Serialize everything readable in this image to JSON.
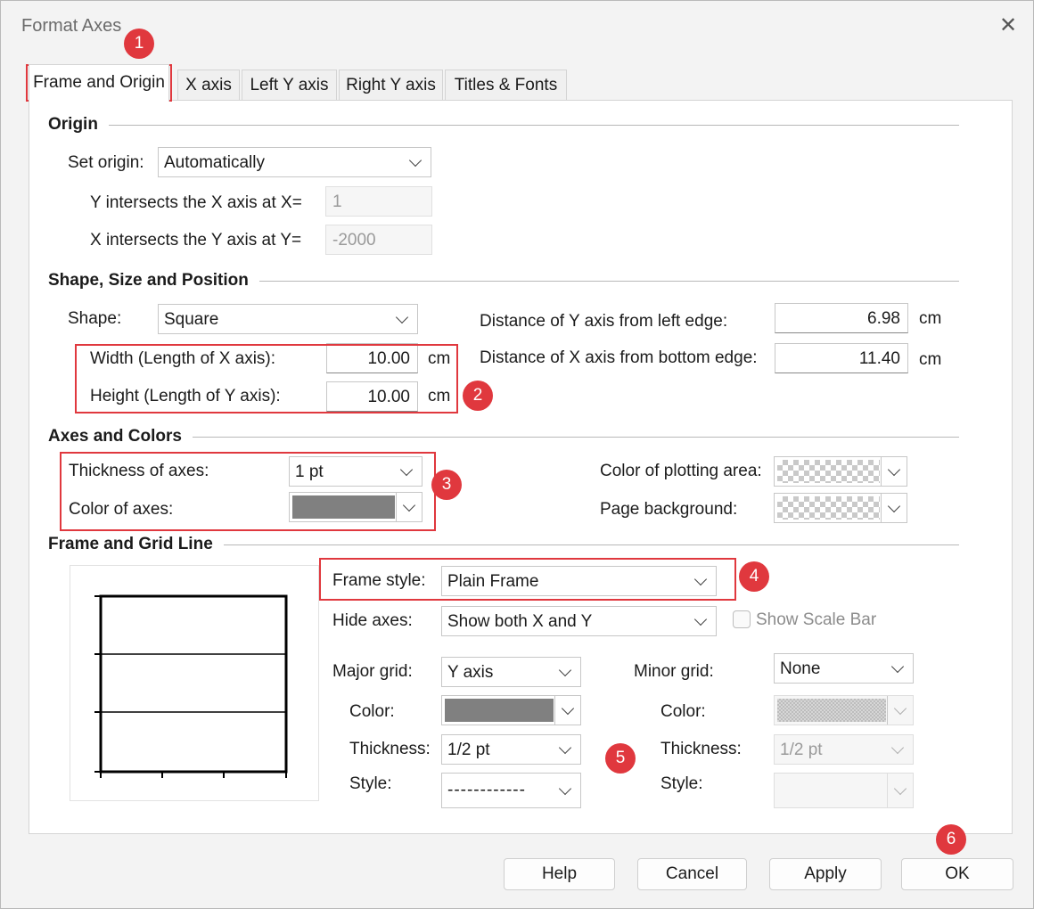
{
  "window": {
    "title": "Format Axes"
  },
  "tabs": [
    {
      "label": "Frame and Origin"
    },
    {
      "label": "X axis"
    },
    {
      "label": "Left Y axis"
    },
    {
      "label": "Right Y axis"
    },
    {
      "label": "Titles & Fonts"
    }
  ],
  "origin": {
    "section_title": "Origin",
    "set_origin_label": "Set origin:",
    "set_origin_value": "Automatically",
    "y_intersect_label": "Y intersects the X axis at X=",
    "y_intersect_value": "1",
    "x_intersect_label": "X intersects the Y axis at Y=",
    "x_intersect_value": "-2000"
  },
  "shape": {
    "section_title": "Shape, Size and Position",
    "shape_label": "Shape:",
    "shape_value": "Square",
    "width_label": "Width (Length of X axis):",
    "width_value": "10.00",
    "height_label": "Height (Length of Y axis):",
    "height_value": "10.00",
    "unit": "cm",
    "dist_y_label": "Distance of Y axis from left edge:",
    "dist_y_value": "6.98",
    "dist_x_label": "Distance of X axis from bottom edge:",
    "dist_x_value": "11.40"
  },
  "axes_colors": {
    "section_title": "Axes and Colors",
    "thickness_label": "Thickness of axes:",
    "thickness_value": "1 pt",
    "color_axes_label": "Color of axes:",
    "color_axes_hex": "#808080",
    "plot_area_label": "Color of plotting area:",
    "page_bg_label": "Page background:"
  },
  "frame_grid": {
    "section_title": "Frame and Grid Line",
    "frame_style_label": "Frame style:",
    "frame_style_value": "Plain Frame",
    "hide_axes_label": "Hide axes:",
    "hide_axes_value": "Show both X and Y",
    "scale_bar_label": "Show Scale Bar",
    "major_grid_label": "Major grid:",
    "major_grid_value": "Y axis",
    "major_color_label": "Color:",
    "major_color_hex": "#808080",
    "major_thickness_label": "Thickness:",
    "major_thickness_value": "1/2 pt",
    "major_style_label": "Style:",
    "major_style_value": "------------",
    "minor_grid_label": "Minor grid:",
    "minor_grid_value": "None",
    "minor_color_label": "Color:",
    "minor_thickness_label": "Thickness:",
    "minor_thickness_value": "1/2 pt",
    "minor_style_label": "Style:"
  },
  "buttons": {
    "help": "Help",
    "cancel": "Cancel",
    "apply": "Apply",
    "ok": "OK"
  },
  "annotations": [
    "1",
    "2",
    "3",
    "4",
    "5",
    "6"
  ],
  "accent_color": "#e0383e"
}
